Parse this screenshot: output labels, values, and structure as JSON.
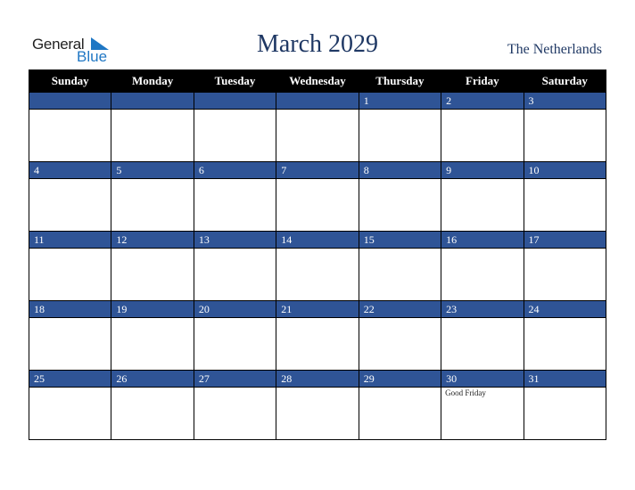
{
  "logo": {
    "general": "General",
    "blue": "Blue"
  },
  "title": "March 2029",
  "country": "The Netherlands",
  "weekdays": [
    "Sunday",
    "Monday",
    "Tuesday",
    "Wednesday",
    "Thursday",
    "Friday",
    "Saturday"
  ],
  "weeks": [
    [
      "",
      "",
      "",
      "",
      "1",
      "2",
      "3"
    ],
    [
      "4",
      "5",
      "6",
      "7",
      "8",
      "9",
      "10"
    ],
    [
      "11",
      "12",
      "13",
      "14",
      "15",
      "16",
      "17"
    ],
    [
      "18",
      "19",
      "20",
      "21",
      "22",
      "23",
      "24"
    ],
    [
      "25",
      "26",
      "27",
      "28",
      "29",
      "30",
      "31"
    ]
  ],
  "holidays": {
    "30": "Good Friday"
  },
  "colors": {
    "band": "#2f5496",
    "header": "#000000",
    "title": "#1f3864",
    "logo_blue": "#1f77c4"
  }
}
